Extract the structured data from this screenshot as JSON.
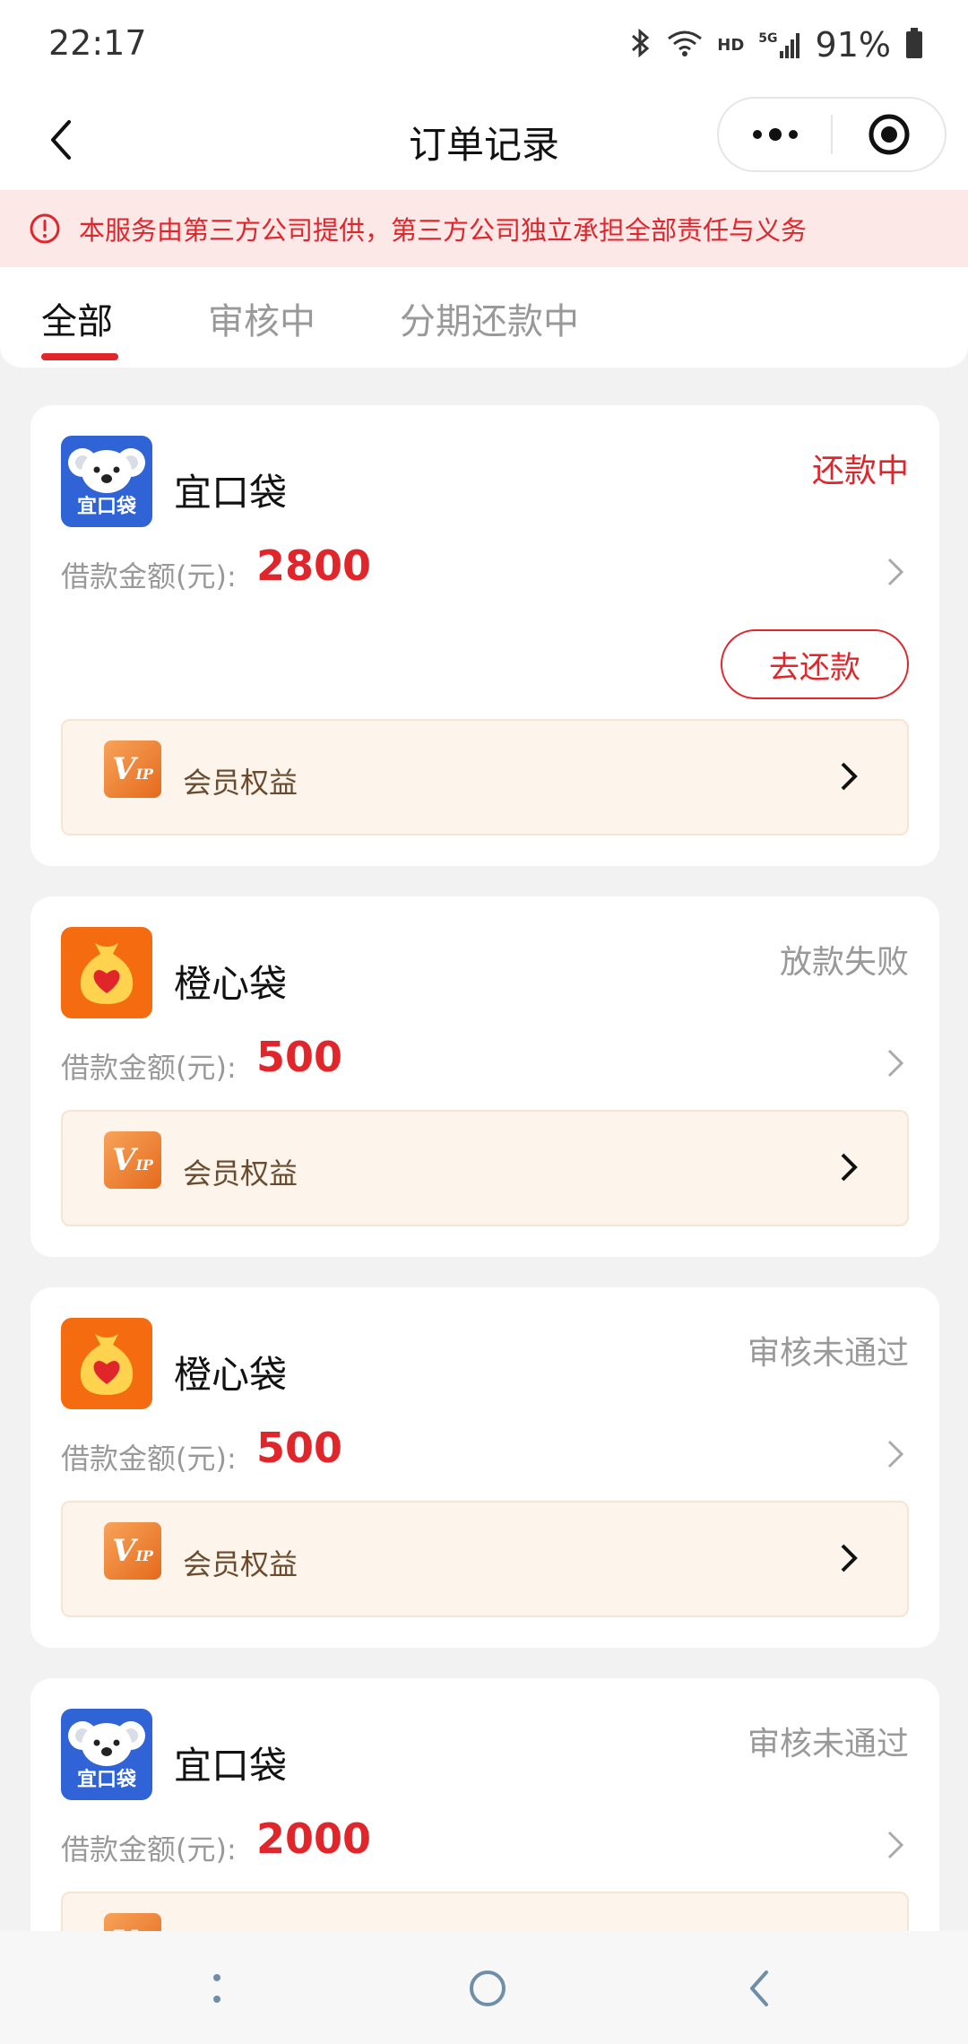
{
  "status_bar": {
    "time": "22:17",
    "hd_label": "HD",
    "network_label": "5G",
    "battery_percent": "91%"
  },
  "navbar": {
    "title": "订单记录",
    "back_icon": "chevron-left-icon",
    "more_icon": "more-dots-icon",
    "close_icon": "target-circle-icon"
  },
  "notice": {
    "icon": "alert-circle-icon",
    "text": "本服务由第三方公司提供，第三方公司独立承担全部责任与义务"
  },
  "tabs": [
    {
      "label": "全部",
      "active": true
    },
    {
      "label": "审核中",
      "active": false
    },
    {
      "label": "分期还款中",
      "active": false
    }
  ],
  "common": {
    "amount_label": "借款金额(元):",
    "vip_label": "会员权益",
    "vip_icon_text": "V",
    "vip_icon_sub": "IP"
  },
  "orders": [
    {
      "app_name": "宜口袋",
      "app_icon": "koala-icon",
      "status": "还款中",
      "status_color": "#e0262b",
      "amount": "2800",
      "action_label": "去还款"
    },
    {
      "app_name": "橙心袋",
      "app_icon": "money-bag-heart-icon",
      "status": "放款失败",
      "status_color": "#999999",
      "amount": "500"
    },
    {
      "app_name": "橙心袋",
      "app_icon": "money-bag-heart-icon",
      "status": "审核未通过",
      "status_color": "#999999",
      "amount": "500"
    },
    {
      "app_name": "宜口袋",
      "app_icon": "koala-icon",
      "status": "审核未通过",
      "status_color": "#999999",
      "amount": "2000"
    }
  ],
  "koala_icon_text": "宜口袋",
  "colors": {
    "accent_red": "#e0262b",
    "notice_bg": "#fde8e8",
    "vip_bg": "#fdf4ec",
    "koala_blue": "#2f63d6",
    "orange": "#f56b0f"
  }
}
